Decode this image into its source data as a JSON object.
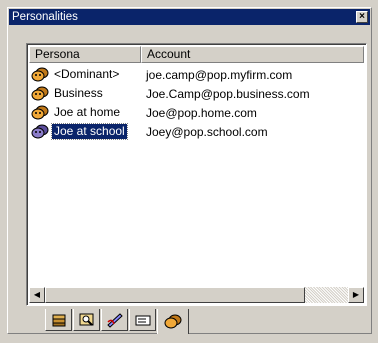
{
  "window": {
    "title": "Personalities",
    "close_glyph": "×"
  },
  "list": {
    "columns": [
      "Persona",
      "Account"
    ],
    "rows": [
      {
        "persona": "<Dominant>",
        "account": "joe.camp@pop.myfirm.com",
        "selected": false
      },
      {
        "persona": "Business",
        "account": "Joe.Camp@pop.business.com",
        "selected": false
      },
      {
        "persona": "Joe at home",
        "account": "Joe@pop.home.com",
        "selected": false
      },
      {
        "persona": "Joe at school",
        "account": "Joey@pop.school.com",
        "selected": true
      }
    ]
  },
  "scrollbar": {
    "left_glyph": "◀",
    "right_glyph": "▶"
  },
  "tabs": [
    {
      "icon": "stack-icon"
    },
    {
      "icon": "magnifier-icon"
    },
    {
      "icon": "pen-icon"
    },
    {
      "icon": "mailbox-icon"
    },
    {
      "icon": "personalities-icon",
      "active": true
    }
  ]
}
